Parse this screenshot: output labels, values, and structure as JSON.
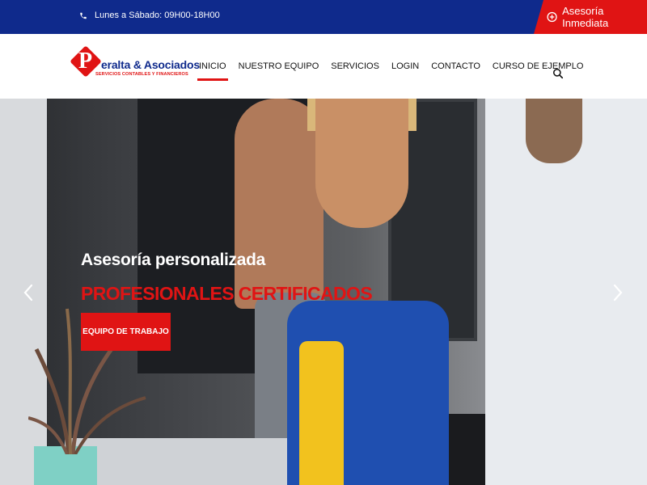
{
  "topbar": {
    "hours": "Lunes a Sábado: 09H00-18H00",
    "cta_label": "Asesoría Inmediata",
    "icons": {
      "hours": "phone-icon",
      "cta": "plus-circle-icon"
    }
  },
  "logo": {
    "initial": "P",
    "name": "eralta & Asociados",
    "tagline": "SERVICIOS CONTABLES Y FINANCIEROS"
  },
  "nav": {
    "items": [
      {
        "label": "INICIO",
        "active": true
      },
      {
        "label": "NUESTRO EQUIPO"
      },
      {
        "label": "SERVICIOS"
      },
      {
        "label": "LOGIN"
      },
      {
        "label": "CONTACTO"
      },
      {
        "label": "CURSO DE EJEMPLO"
      }
    ],
    "search_icon": "search-icon"
  },
  "hero": {
    "title": "Asesoría personalizada",
    "subtitle": "PROFESIONALES CERTIFICADOS",
    "button_label": "EQUIPO DE TRABAJO",
    "prev_icon": "chevron-left-icon",
    "next_icon": "chevron-right-icon"
  },
  "colors": {
    "primary_blue": "#0f2a8c",
    "accent_red": "#e01414"
  }
}
